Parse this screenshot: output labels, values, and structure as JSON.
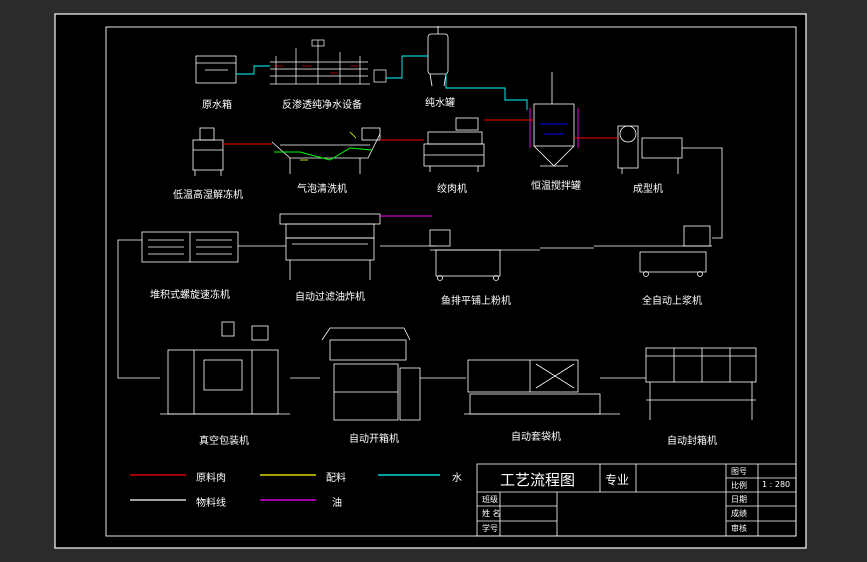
{
  "title_block": {
    "title": "工艺流程图",
    "major": "专业",
    "fields": {
      "drawing_no": "图号",
      "scale_label": "比例",
      "scale_value": "1 : 280",
      "date": "日期",
      "score": "成绩",
      "review": "审核",
      "class": "班级",
      "name": "姓 名",
      "student_no": "学号"
    }
  },
  "machines": {
    "raw_water_tank": "原水箱",
    "ro_equipment": "反渗透纯净水设备",
    "pure_water_tank": "纯水罐",
    "thawing_machine": "低温高湿解冻机",
    "bubble_washer": "气泡清洗机",
    "meat_grinder": "绞肉机",
    "mixing_tank": "恒温搅拌罐",
    "forming_machine": "成型机",
    "spiral_freezer": "堆积式螺旋速冻机",
    "fryer": "自动过滤油炸机",
    "breading_machine": "鱼排平铺上粉机",
    "battering_machine": "全自动上浆机",
    "vacuum_packer": "真空包装机",
    "case_erector": "自动开箱机",
    "bagging_machine": "自动套袋机",
    "case_sealer": "自动封箱机"
  },
  "legend": {
    "raw_meat": "原料肉",
    "ingredients": "配料",
    "water": "水",
    "material_line": "物料线",
    "oil": "油"
  },
  "colors": {
    "background": "#000000",
    "frame": "#ffffff",
    "raw_meat": "#ff0000",
    "ingredients": "#ffff00",
    "water": "#00ffff",
    "material_line": "#ffffff",
    "oil": "#ff00ff"
  }
}
